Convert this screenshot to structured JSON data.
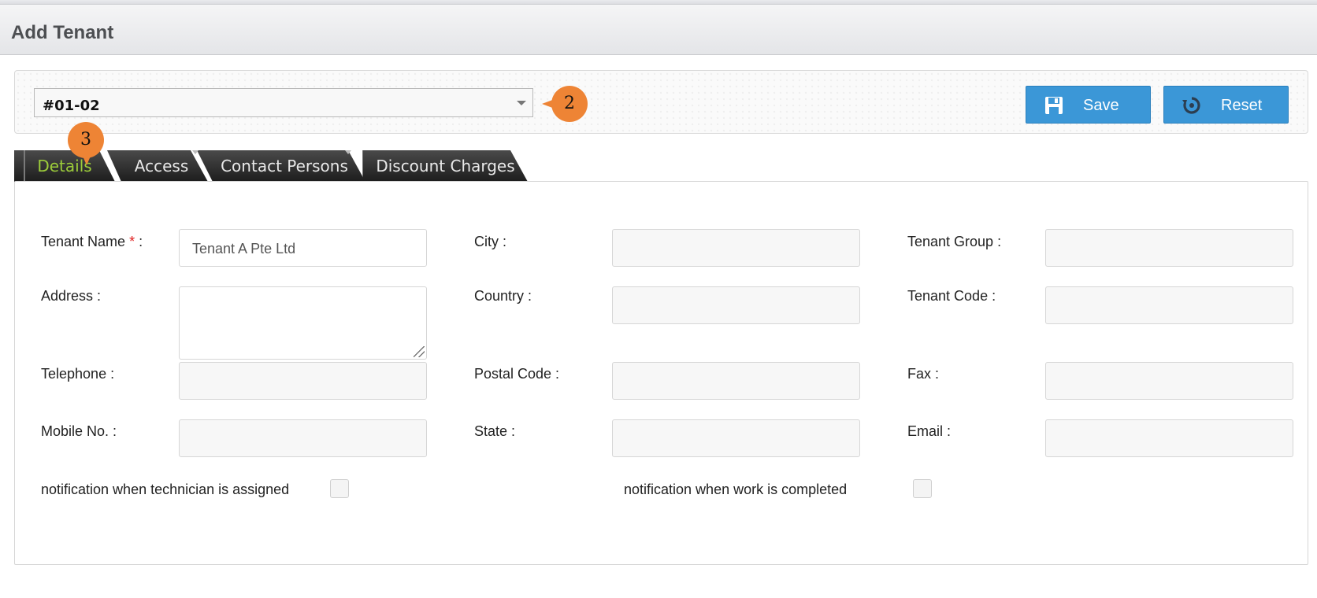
{
  "header": {
    "title": "Add Tenant"
  },
  "toolbar": {
    "unit_value": "#01-02",
    "save_label": "Save",
    "reset_label": "Reset"
  },
  "callouts": {
    "unit": "2",
    "tabs": "3"
  },
  "tabs": [
    {
      "label": "Details",
      "active": true
    },
    {
      "label": "Access",
      "active": false
    },
    {
      "label": "Contact Persons",
      "active": false
    },
    {
      "label": "Discount Charges",
      "active": false
    }
  ],
  "form": {
    "tenant_name": {
      "label": "Tenant Name",
      "required_mark": "*",
      "suffix": " :",
      "value": "Tenant A Pte Ltd"
    },
    "address": {
      "label": "Address :",
      "value": ""
    },
    "telephone": {
      "label": "Telephone :",
      "value": ""
    },
    "mobile": {
      "label": "Mobile No. :",
      "value": ""
    },
    "city": {
      "label": "City :",
      "value": ""
    },
    "country": {
      "label": "Country :",
      "value": ""
    },
    "postal_code": {
      "label": "Postal Code :",
      "value": ""
    },
    "state": {
      "label": "State :",
      "value": ""
    },
    "tenant_group": {
      "label": "Tenant Group :",
      "value": ""
    },
    "tenant_code": {
      "label": "Tenant Code :",
      "value": ""
    },
    "fax": {
      "label": "Fax :",
      "value": ""
    },
    "email": {
      "label": "Email :",
      "value": ""
    },
    "notify_assigned": {
      "label": "notification when technician is assigned",
      "checked": false
    },
    "notify_completed": {
      "label": "notification when work is completed",
      "checked": false
    }
  },
  "colors": {
    "accent_blue": "#3b97d7",
    "callout_orange": "#ee8435",
    "active_tab_text": "#9ccc3a",
    "required_red": "#e02020"
  },
  "icons": {
    "save": "floppy-disk-icon",
    "reset": "reset-arrow-icon",
    "select": "chevron-down-icon"
  }
}
